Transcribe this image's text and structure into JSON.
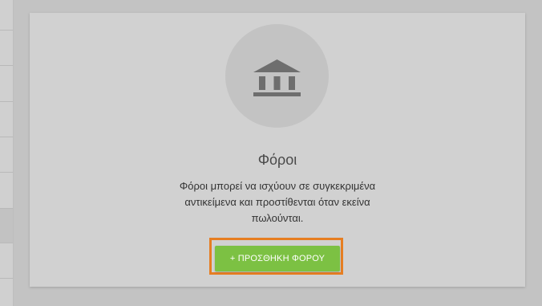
{
  "sidebar": {
    "rows": 8,
    "selected_index": 6
  },
  "empty_state": {
    "icon": "bank-icon",
    "title": "Φόροι",
    "description_line1": "Φόροι μπορεί να ισχύουν σε συγκεκριμένα",
    "description_line2": "αντικείμενα και προστίθενται όταν εκείνα",
    "description_line3": "πωλούνται.",
    "add_button_label": "+ ΠΡΟΣΘΗΚΗ ΦΟΡΟΥ"
  },
  "colors": {
    "button": "#7cc143",
    "highlight": "#e67e22",
    "icon": "#6e6e6e"
  }
}
